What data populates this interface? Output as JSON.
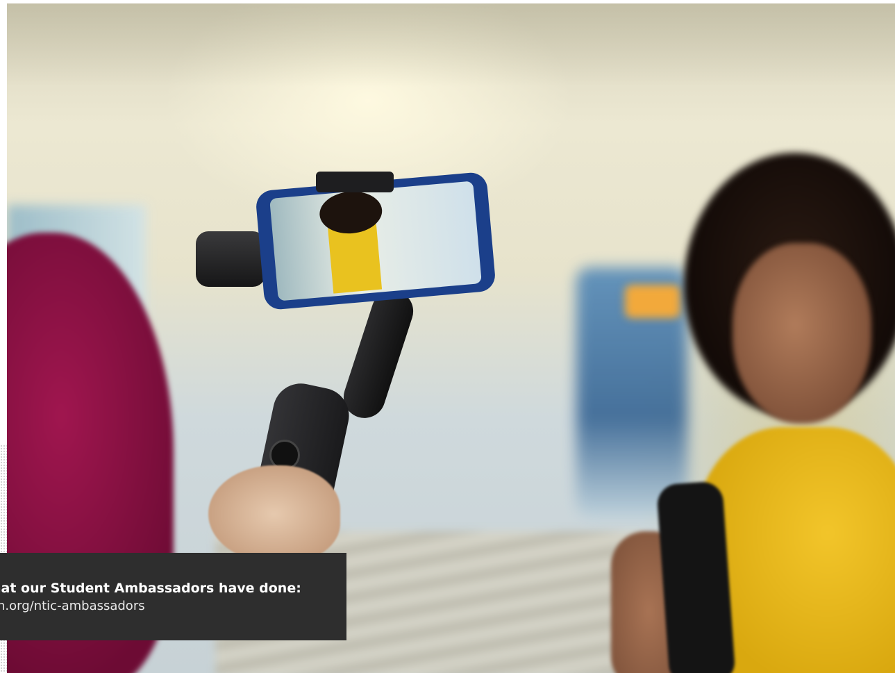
{
  "caption": {
    "title": "hat our Student Ambassadors have done:",
    "url": "n.org/ntic-ambassadors"
  }
}
